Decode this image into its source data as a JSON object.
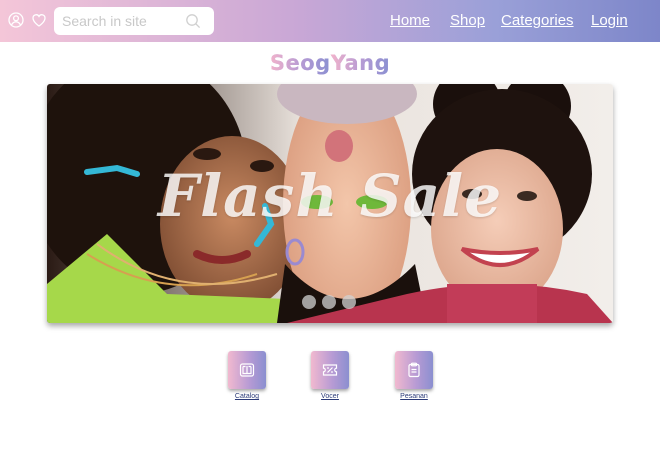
{
  "nav": {
    "search_placeholder": "Search in site",
    "links": [
      {
        "label": "Home"
      },
      {
        "label": "Shop"
      },
      {
        "label": "Categories"
      },
      {
        "label": "Login"
      }
    ],
    "icons": [
      "user-icon",
      "heart-icon",
      "search-icon"
    ]
  },
  "brand": {
    "name_part1": "Seog",
    "name_part2": "Yang"
  },
  "hero": {
    "title": "Flash Sale",
    "slides_count": 3
  },
  "quick_links": [
    {
      "label": "Catalog",
      "icon": "book-icon"
    },
    {
      "label": "Vocer",
      "icon": "ticket-icon"
    },
    {
      "label": "Pesanan",
      "icon": "clipboard-icon"
    }
  ],
  "colors": {
    "gradient_start": "#f4c6d8",
    "gradient_mid": "#c9a7d6",
    "gradient_end": "#7d86c9",
    "label_color": "#2b3a78"
  }
}
